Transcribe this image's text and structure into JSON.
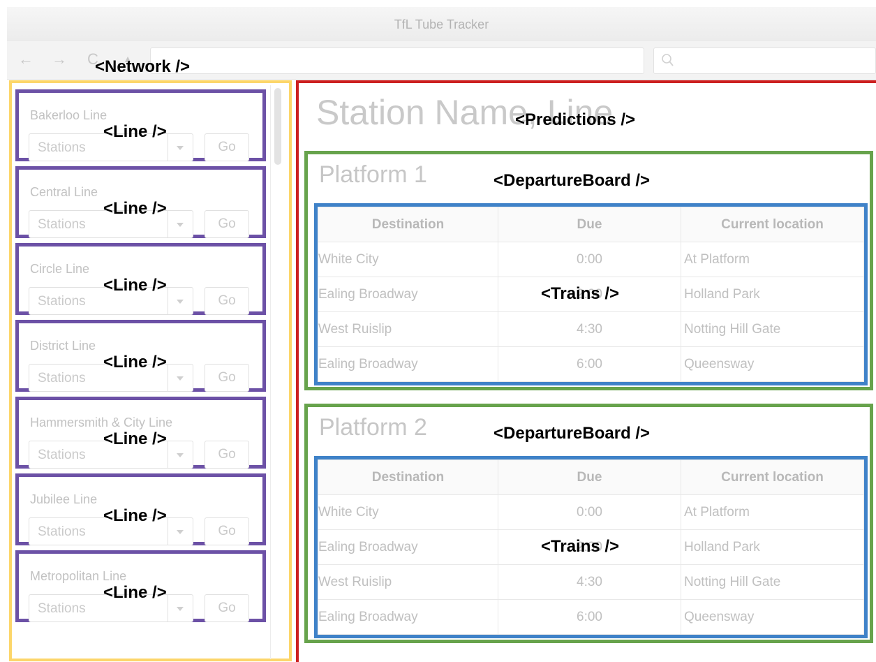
{
  "window": {
    "title": "TfL Tube Tracker"
  },
  "toolbar": {
    "back_glyph": "←",
    "forward_glyph": "→",
    "reload_glyph": "C",
    "home_glyph": "▲",
    "address_value": "",
    "search_value": ""
  },
  "annotations": {
    "network": "<Network />",
    "line": "<Line />",
    "predictions": "<Predictions />",
    "departure_board": "<DepartureBoard />",
    "trains": "<Trains />"
  },
  "colors": {
    "network_outline": "#fcd66a",
    "line_outline": "#6c51a6",
    "predictions_outline": "#cc1f1f",
    "departure_board_outline": "#67a34c",
    "trains_outline": "#3f82c8"
  },
  "network": {
    "lines": [
      {
        "name": "Bakerloo Line",
        "select_placeholder": "Stations",
        "go_label": "Go"
      },
      {
        "name": "Central Line",
        "select_placeholder": "Stations",
        "go_label": "Go"
      },
      {
        "name": "Circle Line",
        "select_placeholder": "Stations",
        "go_label": "Go"
      },
      {
        "name": "District Line",
        "select_placeholder": "Stations",
        "go_label": "Go"
      },
      {
        "name": "Hammersmith & City Line",
        "select_placeholder": "Stations",
        "go_label": "Go"
      },
      {
        "name": "Jubilee Line",
        "select_placeholder": "Stations",
        "go_label": "Go"
      },
      {
        "name": "Metropolitan Line",
        "select_placeholder": "Stations",
        "go_label": "Go"
      }
    ]
  },
  "predictions": {
    "station_title": "Station Name, Line",
    "boards": [
      {
        "platform": "Platform 1",
        "columns": [
          "Destination",
          "Due",
          "Current location"
        ],
        "rows": [
          [
            "White City",
            "0:00",
            "At Platform"
          ],
          [
            "Ealing Broadway",
            "2:00",
            "Holland Park"
          ],
          [
            "West Ruislip",
            "4:30",
            "Notting Hill Gate"
          ],
          [
            "Ealing Broadway",
            "6:00",
            "Queensway"
          ]
        ]
      },
      {
        "platform": "Platform 2",
        "columns": [
          "Destination",
          "Due",
          "Current location"
        ],
        "rows": [
          [
            "White City",
            "0:00",
            "At Platform"
          ],
          [
            "Ealing Broadway",
            "2:00",
            "Holland Park"
          ],
          [
            "West Ruislip",
            "4:30",
            "Notting Hill Gate"
          ],
          [
            "Ealing Broadway",
            "6:00",
            "Queensway"
          ]
        ]
      }
    ]
  }
}
